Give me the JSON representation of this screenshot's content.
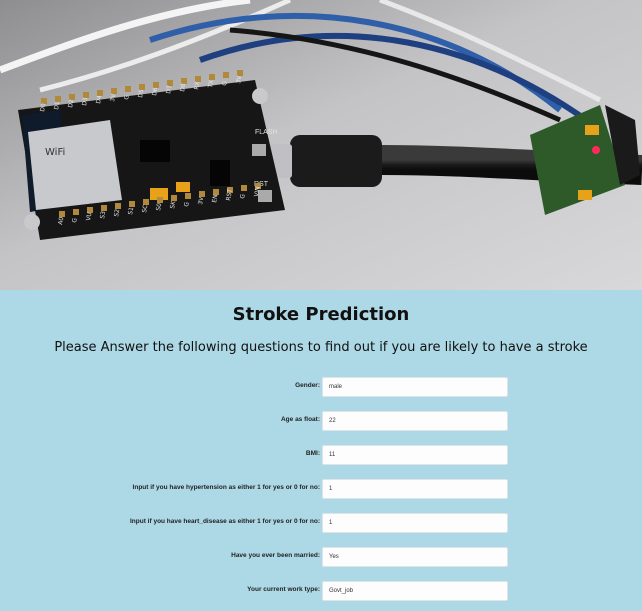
{
  "header": {
    "title": "Stroke Prediction",
    "subtitle": "Please Answer the following questions to find out if you are likely to have a stroke"
  },
  "board_markings": {
    "module": "WiFi",
    "flash": "FLASH",
    "rst": "RST",
    "pins_top": [
      "D0",
      "D1",
      "D2",
      "D3",
      "D4",
      "3V",
      "G",
      "D5",
      "D6",
      "D7",
      "D8",
      "RX",
      "TX",
      "G",
      "3V"
    ],
    "pins_bottom": [
      "A0",
      "G",
      "VU",
      "S3",
      "S2",
      "S1",
      "SC",
      "S0",
      "SK",
      "G",
      "3V",
      "EN",
      "RST",
      "G",
      "VIN"
    ]
  },
  "form": {
    "fields": [
      {
        "label": "Gender:",
        "value": "male"
      },
      {
        "label": "Age as float:",
        "value": "22"
      },
      {
        "label": "BMI:",
        "value": "11"
      },
      {
        "label": "Input if you have hypertension as either 1 for yes or 0 for no:",
        "value": "1"
      },
      {
        "label": "Input if you have heart_disease as either 1 for yes or 0 for no:",
        "value": "1"
      },
      {
        "label": "Have you ever been married:",
        "value": "Yes"
      },
      {
        "label": "Your current work type:",
        "value": "Govt_job"
      }
    ]
  },
  "colors": {
    "panel_bg": "#add8e6",
    "input_bg": "#fdfdfd"
  }
}
